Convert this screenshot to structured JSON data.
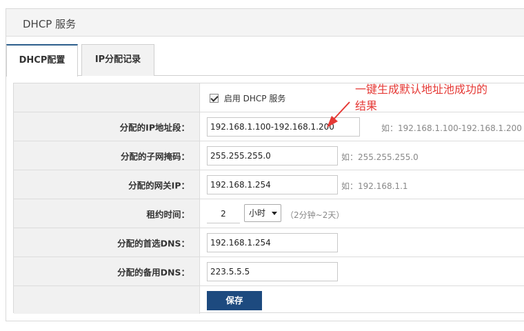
{
  "panel": {
    "title": "DHCP 服务"
  },
  "tabs": [
    {
      "label": "DHCP配置",
      "active": true
    },
    {
      "label": "IP分配记录",
      "active": false
    }
  ],
  "form": {
    "enable": {
      "label": "启用 DHCP 服务",
      "checked": true
    },
    "ip_range": {
      "label": "分配的IP地址段：",
      "value": "192.168.1.100-192.168.1.200",
      "hint": "如：192.168.1.100-192.168.1.200"
    },
    "subnet": {
      "label": "分配的子网掩码：",
      "value": "255.255.255.0",
      "hint": "如：255.255.255.0"
    },
    "gateway": {
      "label": "分配的网关IP：",
      "value": "192.168.1.254",
      "hint": "如：192.168.1.1"
    },
    "lease": {
      "label": "租约时间：",
      "value": "2",
      "unit": "小时",
      "hint": "（2分钟~2天）"
    },
    "dns_primary": {
      "label": "分配的首选DNS：",
      "value": "192.168.1.254"
    },
    "dns_backup": {
      "label": "分配的备用DNS：",
      "value": "223.5.5.5"
    },
    "save_label": "保存"
  },
  "annotation": {
    "line1": "一键生成默认地址池成功的",
    "line2": "结果",
    "color": "#e53935"
  }
}
